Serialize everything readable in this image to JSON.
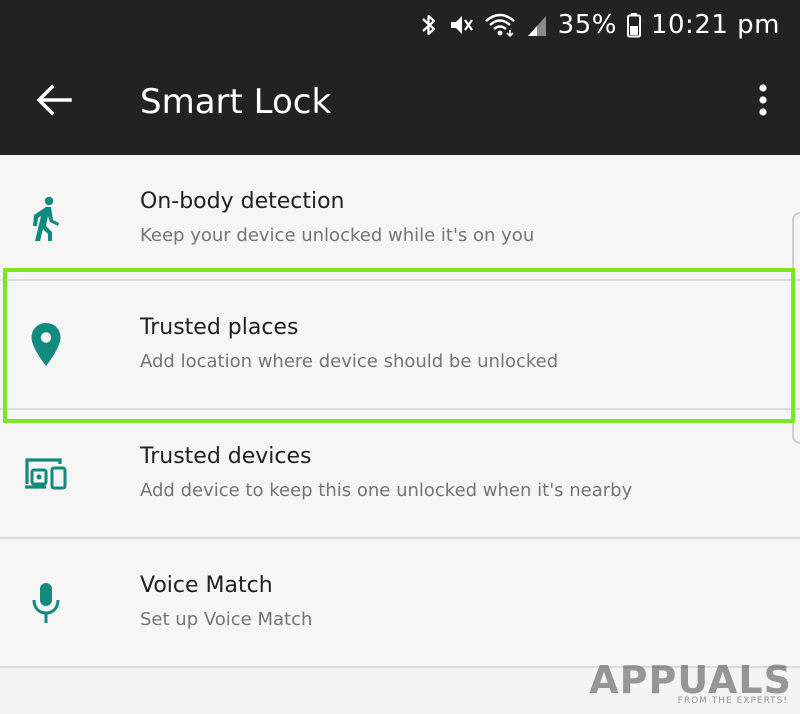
{
  "status_bar": {
    "battery_percent": "35%",
    "time": "10:21 pm",
    "icons": [
      "bluetooth-icon",
      "vibrate-mute-icon",
      "wifi-icon",
      "signal-icon",
      "battery-icon"
    ]
  },
  "app_bar": {
    "title": "Smart Lock",
    "back_icon": "arrow-back-icon",
    "overflow_icon": "more-vert-icon"
  },
  "items": [
    {
      "title": "On-body detection",
      "subtitle": "Keep your device unlocked while it's on you",
      "icon": "walking-person-icon"
    },
    {
      "title": "Trusted places",
      "subtitle": "Add location where device should be unlocked",
      "icon": "location-pin-icon"
    },
    {
      "title": "Trusted devices",
      "subtitle": "Add device to keep this one unlocked when it's nearby",
      "icon": "devices-icon"
    },
    {
      "title": "Voice Match",
      "subtitle": "Set up Voice Match",
      "icon": "microphone-icon"
    }
  ],
  "colors": {
    "accent": "#138a7e",
    "app_bar_bg": "#222222",
    "highlight": "#7ee51f",
    "list_bg": "#f6f6f6"
  },
  "watermark": {
    "word": "APPUALS",
    "tagline": "FROM THE EXPERTS!"
  }
}
